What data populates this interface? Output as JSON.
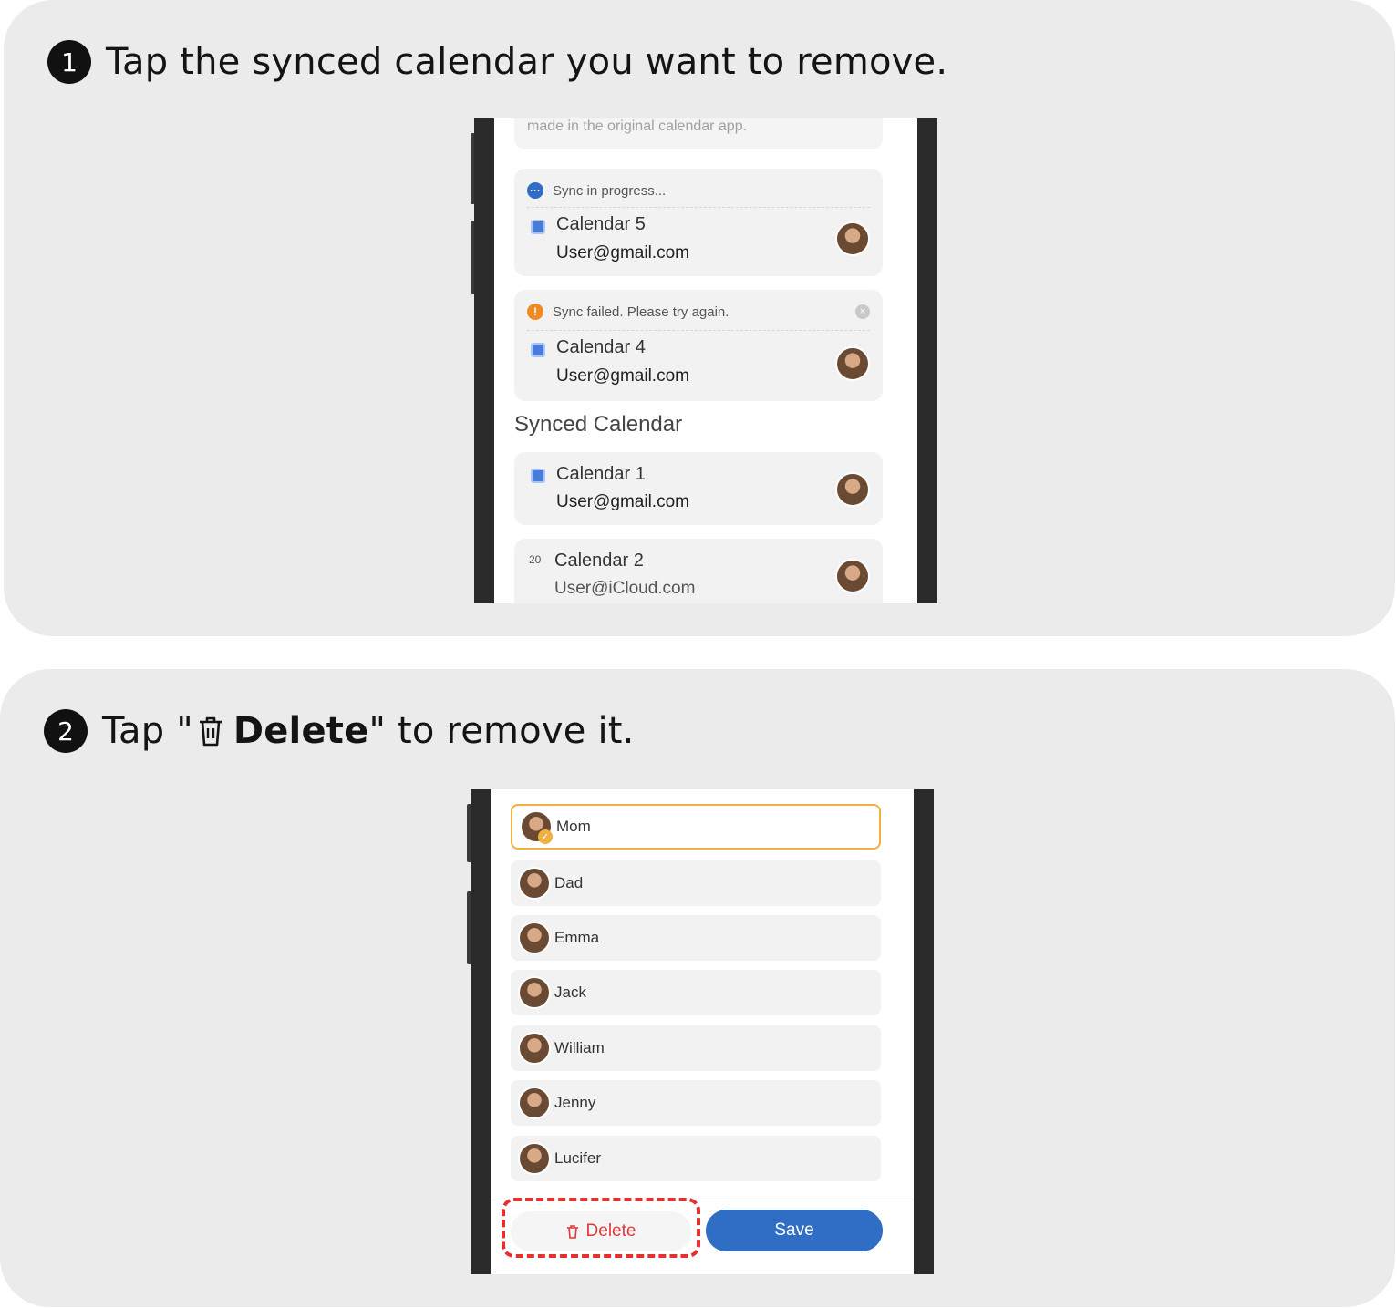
{
  "step1": {
    "number": "1",
    "instruction": "Tap the synced calendar you want to remove.",
    "screen": {
      "top_hint": "made in the original calendar app.",
      "cards": [
        {
          "status": "Sync in progress...",
          "status_type": "progress",
          "name": "Calendar 5",
          "email": "User@gmail.com"
        },
        {
          "status": "Sync failed. Please try again.",
          "status_type": "failed",
          "name": "Calendar 4",
          "email": "User@gmail.com"
        }
      ],
      "section_title": "Synced Calendar",
      "synced": [
        {
          "name": "Calendar 1",
          "email": "User@gmail.com",
          "icon": "google-calendar-icon"
        },
        {
          "name": "Calendar 2",
          "email": "User@iCloud.com",
          "icon": "apple-calendar-icon",
          "icon_text": "20"
        }
      ]
    }
  },
  "step2": {
    "number": "2",
    "instruction_prefix": "Tap \"",
    "instruction_bold": "Delete",
    "instruction_suffix": "\" to remove it.",
    "screen": {
      "members": [
        "Mom",
        "Dad",
        "Emma",
        "Jack",
        "William",
        "Jenny",
        "Lucifer"
      ],
      "selected_member": "Mom",
      "delete_label": "Delete",
      "save_label": "Save"
    }
  },
  "colors": {
    "accent_blue": "#2f6ec4",
    "delete_red": "#e0373a",
    "highlight_red": "#e53030",
    "selected_border": "#f0b040"
  }
}
